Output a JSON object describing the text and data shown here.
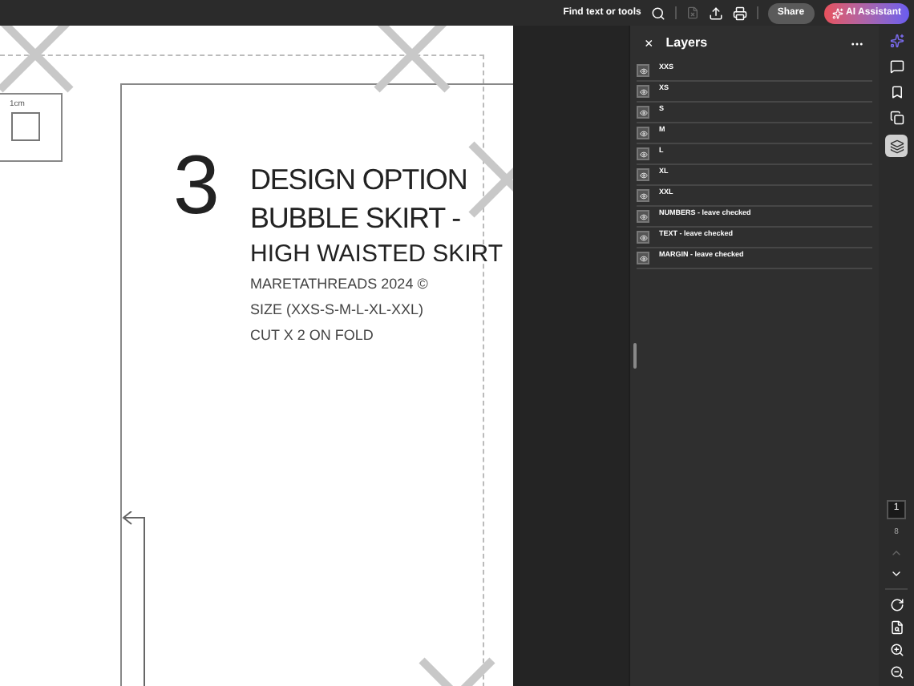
{
  "toolbar": {
    "search_label": "Find text or tools",
    "share": "Share",
    "ai_assistant": "AI Assistant"
  },
  "document": {
    "scale_label": "1cm",
    "number": "3",
    "title_lines": [
      "DESIGN OPTION",
      "BUBBLE SKIRT -"
    ],
    "subtitle": "HIGH WAISTED SKIRT",
    "details": [
      "MARETATHREADS 2024 ©",
      "SIZE (XXS-S-M-L-XL-XXL)",
      "CUT X 2 ON FOLD"
    ]
  },
  "layers_panel": {
    "close": "×",
    "title": "Layers",
    "layers": [
      {
        "name": "XXS"
      },
      {
        "name": "XS"
      },
      {
        "name": "S"
      },
      {
        "name": "M"
      },
      {
        "name": "L"
      },
      {
        "name": "XL"
      },
      {
        "name": "XXL"
      },
      {
        "name": "NUMBERS - leave checked"
      },
      {
        "name": "TEXT - leave checked"
      },
      {
        "name": "MARGIN - leave checked"
      }
    ]
  },
  "rail": {
    "tools": [
      {
        "kind": "ai",
        "selected": false
      },
      {
        "kind": "comment",
        "selected": false
      },
      {
        "kind": "bookmark",
        "selected": false
      },
      {
        "kind": "pages",
        "selected": false
      },
      {
        "kind": "layers",
        "selected": true
      }
    ],
    "page_number": "1",
    "page_count": "8"
  }
}
